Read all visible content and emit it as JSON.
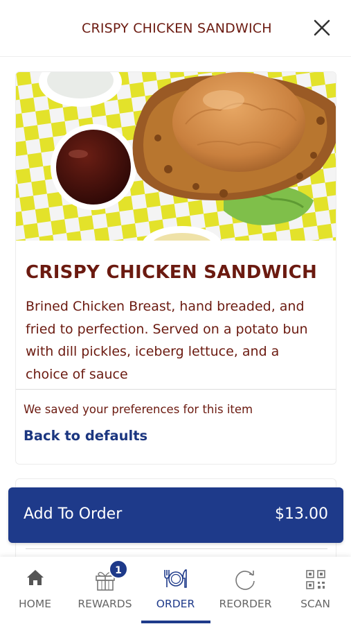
{
  "header": {
    "title": "CRISPY CHICKEN SANDWICH",
    "close_icon": "close-icon"
  },
  "item": {
    "title": "CRISPY CHICKEN SANDWICH",
    "description": "Brined Chicken Breast, hand breaded, and fried to perfection. Served on a potato bun with dill pickles, iceberg lettuce, and a choice of sauce",
    "image": "crispy-chicken-sandwich-photo"
  },
  "preferences": {
    "saved_text": "We saved your preferences for this item",
    "reset_label": "Back to defaults"
  },
  "order_button": {
    "label": "Add To Order",
    "price": "$13.00"
  },
  "nav": {
    "items": [
      {
        "label": "HOME",
        "icon": "home-icon"
      },
      {
        "label": "REWARDS",
        "icon": "gift-icon",
        "badge": "1"
      },
      {
        "label": "ORDER",
        "icon": "utensils-icon",
        "active": true
      },
      {
        "label": "REORDER",
        "icon": "reorder-icon"
      },
      {
        "label": "SCAN",
        "icon": "qr-code-icon"
      }
    ]
  },
  "colors": {
    "brand_red": "#6b1a10",
    "brand_blue": "#1e3a8a",
    "checker_yellow": "#e3e22a",
    "nav_inactive": "#666666"
  }
}
